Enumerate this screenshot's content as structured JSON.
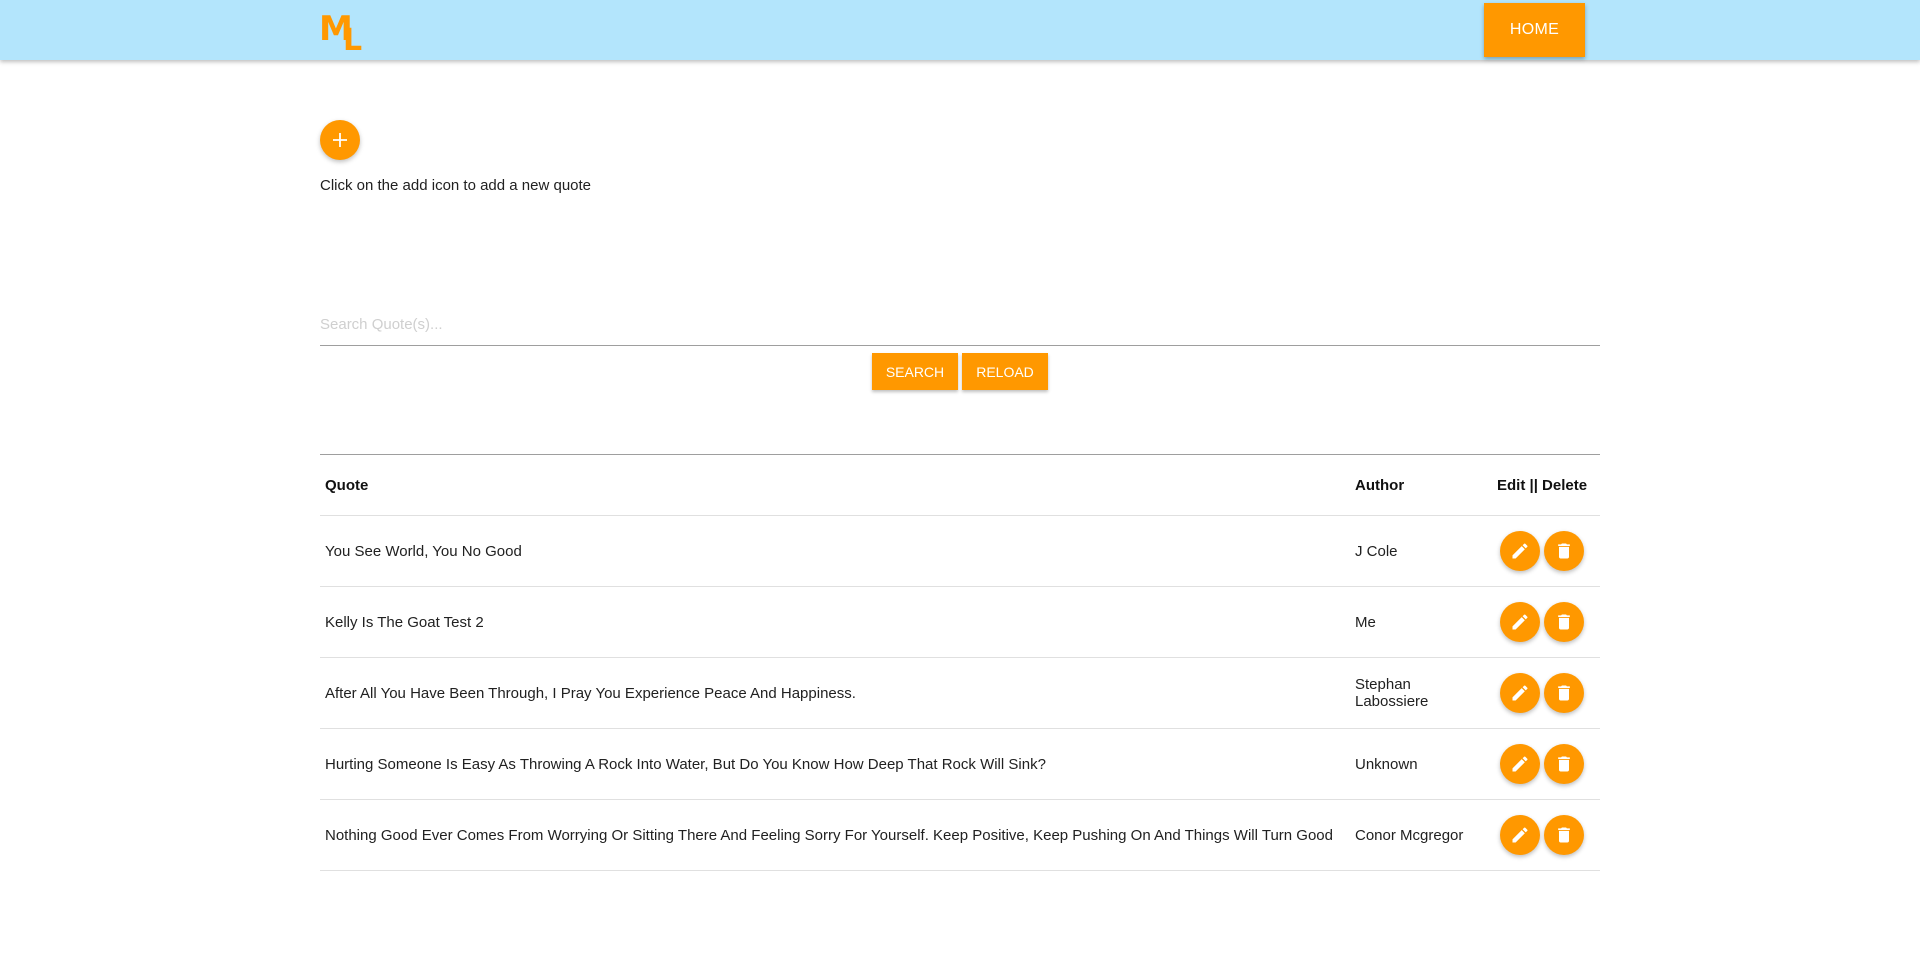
{
  "navbar": {
    "logo_m": "M",
    "logo_l": "L",
    "home_label": "HOME"
  },
  "add": {
    "icon": "plus-icon",
    "hint": "Click on the add icon to add a new quote"
  },
  "search": {
    "placeholder": "Search Quote(s)...",
    "value": "",
    "search_label": "SEARCH",
    "reload_label": "RELOAD"
  },
  "table": {
    "headers": {
      "quote": "Quote",
      "author": "Author",
      "actions": "Edit || Delete"
    },
    "rows": [
      {
        "quote": "You See World, You No Good",
        "author": "J Cole"
      },
      {
        "quote": "Kelly Is The Goat Test 2",
        "author": "Me"
      },
      {
        "quote": "After All You Have Been Through, I Pray You Experience Peace And Happiness.",
        "author": "Stephan Labossiere"
      },
      {
        "quote": "Hurting Someone Is Easy As Throwing A Rock Into Water, But Do You Know How Deep That Rock Will Sink?",
        "author": "Unknown"
      },
      {
        "quote": "Nothing Good Ever Comes From Worrying Or Sitting There And Feeling Sorry For Yourself. Keep Positive, Keep Pushing On And Things Will Turn Good",
        "author": "Conor Mcgregor"
      }
    ],
    "edit_icon": "pencil-icon",
    "delete_icon": "trash-icon"
  },
  "colors": {
    "navbar_bg": "#b3e5fc",
    "accent": "#ff9800"
  }
}
